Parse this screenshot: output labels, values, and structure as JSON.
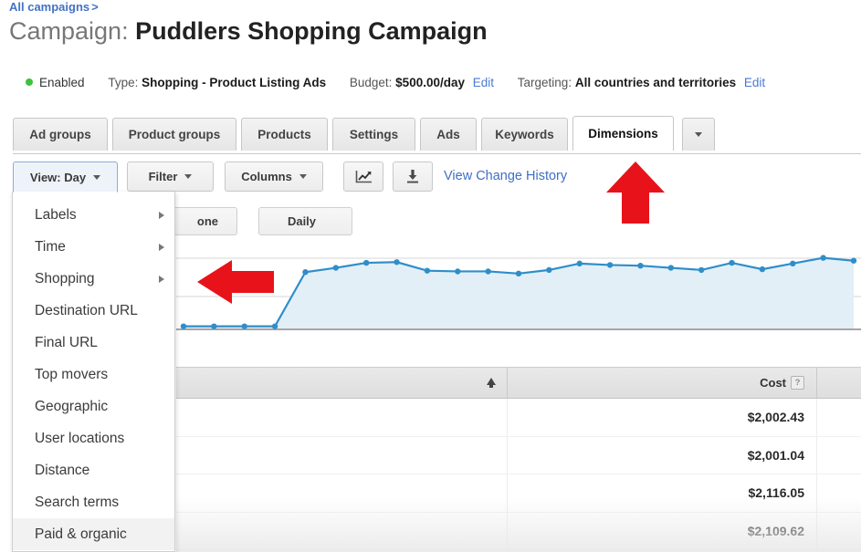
{
  "breadcrumb": {
    "link": "All campaigns",
    "separator": ">"
  },
  "page_title": {
    "label": "Campaign:",
    "name": "Puddlers Shopping Campaign"
  },
  "status_row": {
    "status": "Enabled",
    "type_label": "Type:",
    "type_value": "Shopping - Product Listing Ads",
    "budget_label": "Budget:",
    "budget_value": "$500.00/day",
    "budget_edit": "Edit",
    "targeting_label": "Targeting:",
    "targeting_value": "All countries and territories",
    "targeting_edit": "Edit"
  },
  "tabs": [
    {
      "label": "Ad groups",
      "active": false
    },
    {
      "label": "Product groups",
      "active": false
    },
    {
      "label": "Products",
      "active": false
    },
    {
      "label": "Settings",
      "active": false
    },
    {
      "label": "Ads",
      "active": false
    },
    {
      "label": "Keywords",
      "active": false
    },
    {
      "label": "Dimensions",
      "active": true
    }
  ],
  "tabs_overflow_icon": "chevron-down-icon",
  "toolbar": {
    "view_button": "View: Day",
    "filter_button": "Filter",
    "columns_button": "Columns",
    "chart_icon": "line-chart-icon",
    "download_icon": "download-icon",
    "change_history_link": "View Change History"
  },
  "toolbar_secondary": {
    "segment_button": "one",
    "period_button": "Daily"
  },
  "view_menu": {
    "items": [
      {
        "label": "Labels",
        "has_submenu": true
      },
      {
        "label": "Time",
        "has_submenu": true
      },
      {
        "label": "Shopping",
        "has_submenu": true
      },
      {
        "label": "Destination URL",
        "has_submenu": false
      },
      {
        "label": "Final URL",
        "has_submenu": false
      },
      {
        "label": "Top movers",
        "has_submenu": false
      },
      {
        "label": "Geographic",
        "has_submenu": false
      },
      {
        "label": "User locations",
        "has_submenu": false
      },
      {
        "label": "Distance",
        "has_submenu": false
      },
      {
        "label": "Search terms",
        "has_submenu": false
      },
      {
        "label": "Paid & organic",
        "has_submenu": false
      }
    ]
  },
  "table": {
    "columns": [
      "",
      "Cost"
    ],
    "cost_help": "?",
    "rows": [
      {
        "cost": "$2,002.43"
      },
      {
        "cost": "$2,001.04"
      },
      {
        "cost": "$2,116.05"
      },
      {
        "cost": "$2,109.62"
      }
    ]
  },
  "annotations": [
    {
      "name": "arrow-up-dimensions-tab",
      "direction": "up",
      "color": "#e8131a"
    },
    {
      "name": "arrow-left-view-menu",
      "direction": "left",
      "color": "#e8131a"
    }
  ],
  "colors": {
    "link_blue": "#4472c4",
    "enabled_green": "#3ec13e",
    "chart_line": "#2f8ec9",
    "chart_fill": "#e3eff7",
    "annotation_red": "#e8131a",
    "active_tab_bg": "#ffffff"
  },
  "chart_data": {
    "type": "line",
    "title": "",
    "xlabel": "",
    "ylabel": "",
    "grid": true,
    "legend": "none",
    "series": [
      {
        "name": "Cost",
        "values": [
          60,
          60,
          60,
          60,
          1580,
          1700,
          1840,
          1860,
          1620,
          1600,
          1600,
          1540,
          1640,
          1820,
          1780,
          1760,
          1700,
          1640,
          1840,
          1660,
          1820,
          1980,
          1900
        ]
      }
    ],
    "x": [
      "d1",
      "d2",
      "d3",
      "d4",
      "d5",
      "d6",
      "d7",
      "d8",
      "d9",
      "d10",
      "d11",
      "d12",
      "d13",
      "d14",
      "d15",
      "d16",
      "d17",
      "d18",
      "d19",
      "d20",
      "d21",
      "d22",
      "d23"
    ],
    "ylim": [
      0,
      2200
    ],
    "gridlines": [
      2200,
      1700,
      1200
    ]
  }
}
